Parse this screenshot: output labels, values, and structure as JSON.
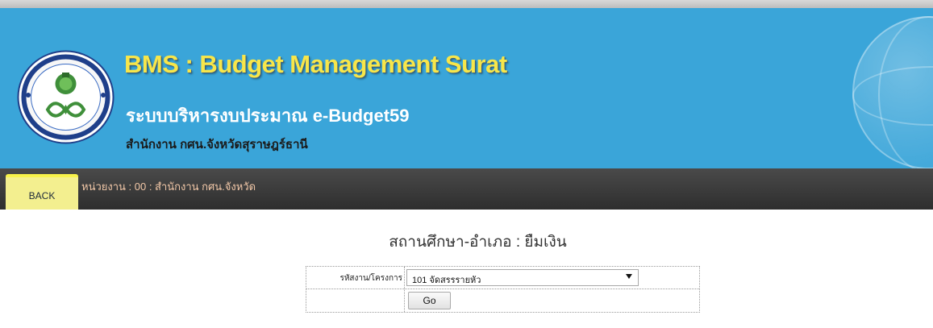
{
  "header": {
    "title": "BMS : Budget Management Surat",
    "subtitle": "ระบบบริหารงบประมาณ e-Budget59",
    "office": "สำนักงาน กศน.จังหวัดสุราษฎร์ธานี",
    "seal_icon": "organization-seal-icon",
    "colors": {
      "banner": "#3aa5d9",
      "title": "#f7e64a"
    }
  },
  "nav": {
    "back_label": "BACK",
    "unit_label": "หน่วยงาน : 00 : สำนักงาน กศน.จังหวัด"
  },
  "main": {
    "heading": "สถานศึกษา-อำเภอ : ยืมเงิน",
    "form": {
      "project_label": "รหัสงาน/โครงการ",
      "project_selected": "101 จัดสรรรายหัว",
      "go_label": "Go"
    }
  }
}
